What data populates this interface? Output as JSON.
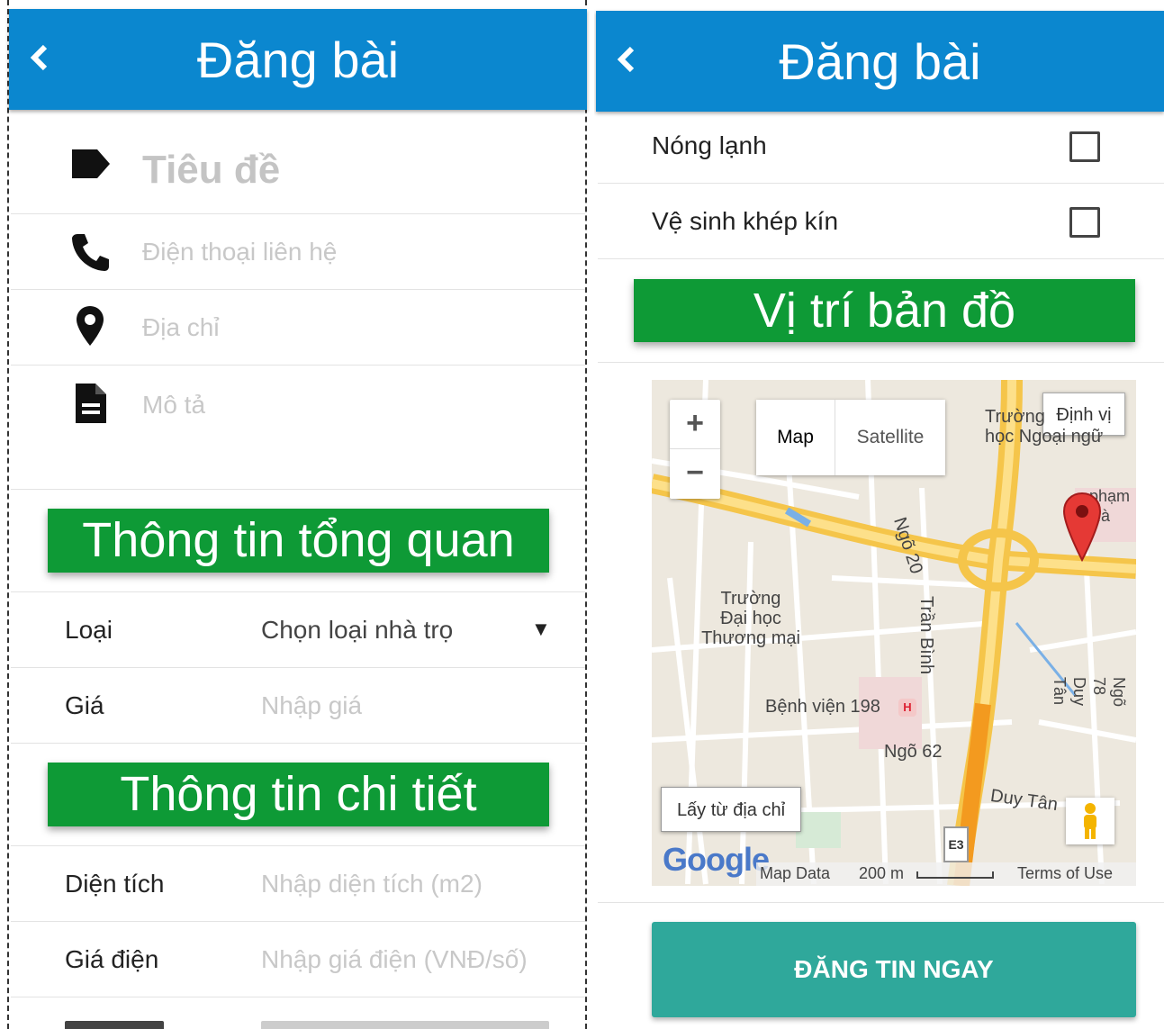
{
  "app": {
    "title": "Đăng bài",
    "back_icon": "chevron-left-icon",
    "bar_color": "#0b87cf"
  },
  "left": {
    "title_placeholder": "Tiêu đề",
    "phone_placeholder": "Điện thoại liên hệ",
    "address_placeholder": "Địa chỉ",
    "description_placeholder": "Mô tả",
    "overview_heading": "Thông tin tổng quan",
    "type_label": "Loại",
    "type_value": "Chọn loại nhà trọ",
    "price_label": "Giá",
    "price_placeholder": "Nhập giá",
    "detail_heading": "Thông tin chi tiết",
    "area_label": "Diện tích",
    "area_placeholder": "Nhập diện tích (m2)",
    "electric_label": "Giá điện",
    "electric_placeholder": "Nhập giá điện (VNĐ/số)"
  },
  "right": {
    "amenities": [
      {
        "label": "Nóng lạnh",
        "checked": false
      },
      {
        "label": "Vệ sinh khép kín",
        "checked": false
      }
    ],
    "map_heading": "Vị trí bản đồ",
    "map": {
      "zoom_in": "+",
      "zoom_out": "−",
      "type_map": "Map",
      "type_satellite": "Satellite",
      "locate": "Định vị",
      "from_address": "Lấy từ địa chỉ",
      "google": "Google",
      "map_data": "Map Data",
      "scale": "200 m",
      "terms": "Terms of Use",
      "labels": {
        "university": "Trường\nĐại học\nThương mại",
        "hospital": "Bệnh viện 198",
        "hospital_badge": "H",
        "lane62": "Ngõ 62",
        "lane20": "Ngõ 20",
        "tranbinh": "Trần Bình",
        "duytan": "Duy Tân",
        "lane78": "Ngõ 78 Duy Tân",
        "foreign_school": "Trường\nhọc Ngoại ngữ",
        "road_e": "E3",
        "pham": "phạm Hà"
      }
    },
    "post_button": "ĐĂNG TIN NGAY"
  },
  "colors": {
    "banner": "#0e9a36",
    "button": "#2fa89b",
    "pin": "#e53935"
  }
}
